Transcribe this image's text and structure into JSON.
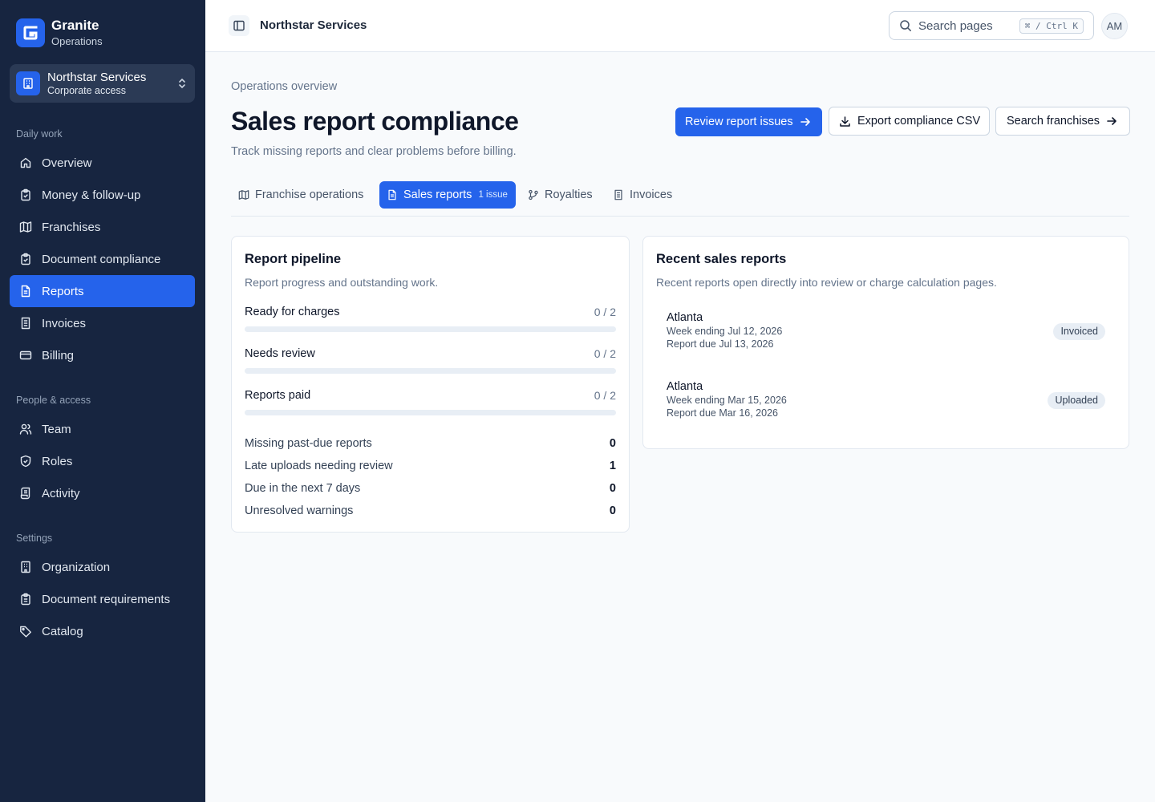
{
  "brand": {
    "name": "Granite",
    "subtitle": "Operations"
  },
  "org_switcher": {
    "name": "Northstar Services",
    "subtitle": "Corporate access"
  },
  "sidebar": {
    "sections": [
      {
        "heading": "Daily work",
        "items": [
          {
            "label": "Overview",
            "icon": "home-icon"
          },
          {
            "label": "Money & follow-up",
            "icon": "clipboard-check-icon"
          },
          {
            "label": "Franchises",
            "icon": "map-icon"
          },
          {
            "label": "Document compliance",
            "icon": "clipboard-check-icon"
          },
          {
            "label": "Reports",
            "icon": "file-text-icon",
            "active": true
          },
          {
            "label": "Invoices",
            "icon": "receipt-icon"
          },
          {
            "label": "Billing",
            "icon": "credit-card-icon"
          }
        ]
      },
      {
        "heading": "People & access",
        "items": [
          {
            "label": "Team",
            "icon": "users-icon"
          },
          {
            "label": "Roles",
            "icon": "shield-icon"
          },
          {
            "label": "Activity",
            "icon": "scroll-icon"
          }
        ]
      },
      {
        "heading": "Settings",
        "items": [
          {
            "label": "Organization",
            "icon": "building-icon"
          },
          {
            "label": "Document requirements",
            "icon": "clipboard-list-icon"
          },
          {
            "label": "Catalog",
            "icon": "tag-icon"
          }
        ]
      }
    ]
  },
  "topbar": {
    "title": "Northstar Services",
    "search_placeholder": "Search pages",
    "shortcut": "⌘ / Ctrl K",
    "avatar_initials": "AM"
  },
  "page": {
    "breadcrumb": "Operations overview",
    "title": "Sales report compliance",
    "subtitle": "Track missing reports and clear problems before billing.",
    "actions": {
      "review": "Review report issues",
      "export": "Export compliance CSV",
      "search": "Search franchises"
    }
  },
  "tabs": [
    {
      "label": "Franchise operations",
      "icon": "map-icon"
    },
    {
      "label": "Sales reports",
      "icon": "file-text-icon",
      "badge": "1 issue",
      "active": true
    },
    {
      "label": "Royalties",
      "icon": "git-branch-icon"
    },
    {
      "label": "Invoices",
      "icon": "receipt-icon"
    }
  ],
  "pipeline": {
    "title": "Report pipeline",
    "description": "Report progress and outstanding work.",
    "progress": [
      {
        "label": "Ready for charges",
        "value": "0 / 2",
        "done": 0,
        "total": 2
      },
      {
        "label": "Needs review",
        "value": "0 / 2",
        "done": 0,
        "total": 2
      },
      {
        "label": "Reports paid",
        "value": "0 / 2",
        "done": 0,
        "total": 2
      }
    ],
    "stats": [
      {
        "label": "Missing past-due reports",
        "value": "0"
      },
      {
        "label": "Late uploads needing review",
        "value": "1"
      },
      {
        "label": "Due in the next 7 days",
        "value": "0"
      },
      {
        "label": "Unresolved warnings",
        "value": "0"
      }
    ]
  },
  "recent": {
    "title": "Recent sales reports",
    "description": "Recent reports open directly into review or charge calculation pages.",
    "items": [
      {
        "city": "Atlanta",
        "week": "Week ending Jul 12, 2026",
        "due": "Report due Jul 13, 2026",
        "status": "Invoiced"
      },
      {
        "city": "Atlanta",
        "week": "Week ending Mar 15, 2026",
        "due": "Report due Mar 16, 2026",
        "status": "Uploaded"
      }
    ]
  },
  "colors": {
    "sidebar": "#172540",
    "accent": "#2563eb",
    "background": "#f8fafc"
  }
}
